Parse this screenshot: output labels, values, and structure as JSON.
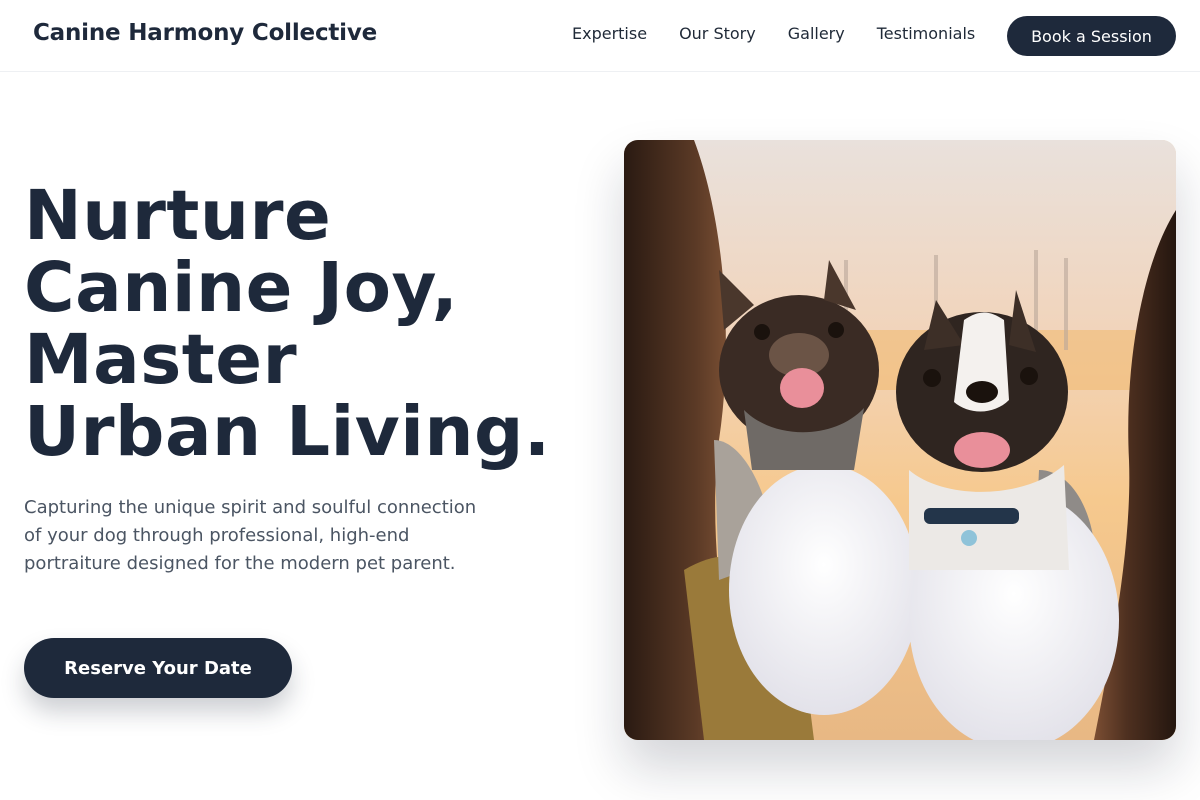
{
  "navbar": {
    "brand": "Canine Harmony Collective",
    "links": [
      "Expertise",
      "Our Story",
      "Gallery",
      "Testimonials"
    ],
    "cta_label": "Book a Session"
  },
  "hero": {
    "title_lines": [
      "Nurture",
      "Canine Joy,",
      "Master",
      "Urban Living."
    ],
    "subtitle": "Capturing the unique spirit and soulful connection of your dog through professional, high-end portraiture designed for the modern pet parent.",
    "cta_label": "Reserve Your Date"
  },
  "colors": {
    "primary": "#1e293b",
    "text_muted": "#4b5563",
    "background": "#ffffff"
  }
}
